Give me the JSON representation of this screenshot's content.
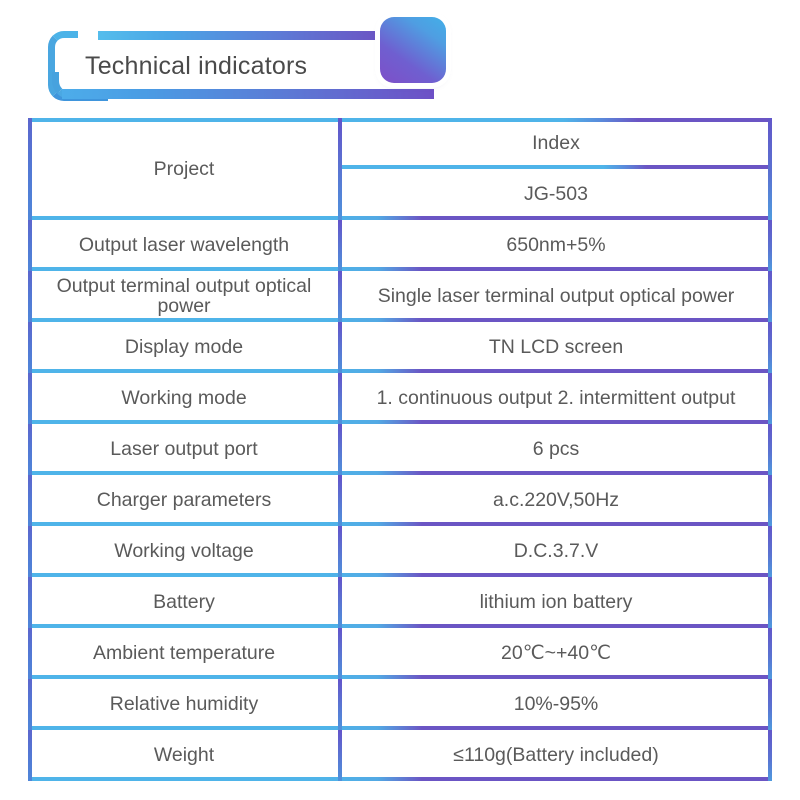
{
  "header": {
    "title": "Technical indicators",
    "accent_blue": "#4fb4e9",
    "accent_purple": "#6b55c4",
    "badge_gradient_from": "#7e4fc8",
    "badge_gradient_to": "#42b0e8"
  },
  "table": {
    "columns": [
      "Project",
      "Index"
    ],
    "first_row": {
      "label": "Project",
      "values": [
        "Index",
        "JG-503"
      ]
    },
    "rows": [
      {
        "label": "Output laser wavelength",
        "value": "650nm+5%"
      },
      {
        "label": "Output terminal output optical power",
        "value": "Single laser terminal output optical power"
      },
      {
        "label": "Display mode",
        "value": "TN LCD screen"
      },
      {
        "label": "Working mode",
        "value": "1. continuous output 2. intermittent output"
      },
      {
        "label": "Laser output port",
        "value": "6 pcs"
      },
      {
        "label": "Charger parameters",
        "value": "a.c.220V,50Hz"
      },
      {
        "label": "Working voltage",
        "value": "D.C.3.7.V"
      },
      {
        "label": "Battery",
        "value": "lithium ion battery"
      },
      {
        "label": "Ambient temperature",
        "value": "20℃~+40℃"
      },
      {
        "label": "Relative humidity",
        "value": "10%-95%"
      },
      {
        "label": "Weight",
        "value": "≤110g(Battery included)"
      }
    ]
  }
}
